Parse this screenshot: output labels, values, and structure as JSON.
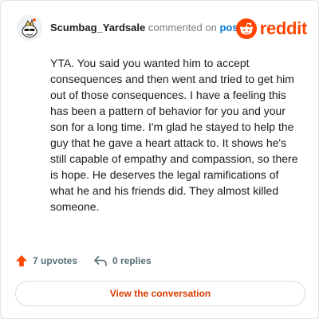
{
  "comment": {
    "username": "Scumbag_Yardsale",
    "action_text": "commented on",
    "target_link": "post",
    "body": "YTA. You said you wanted him to accept consequences and then went and tried to get him out of those consequences. I have a feeling this has been a pattern of behavior for you and your son for a long time. I'm glad he stayed to help the guy that he gave a heart attack to. It shows he's still capable of empathy and compassion, so there is hope. He deserves the legal ramifications of what he and his friends did. They almost killed someone."
  },
  "brand": {
    "wordmark": "reddit",
    "color": "#ff4500"
  },
  "actions": {
    "upvotes_label": "7 upvotes",
    "replies_label": "0 replies",
    "upvote_icon": "upvote-arrow-icon",
    "reply_icon": "reply-arrow-icon"
  },
  "cta": {
    "label": "View the conversation"
  },
  "colors": {
    "link": "#0079d3",
    "accent": "#ff4500",
    "meta": "#576f76"
  }
}
